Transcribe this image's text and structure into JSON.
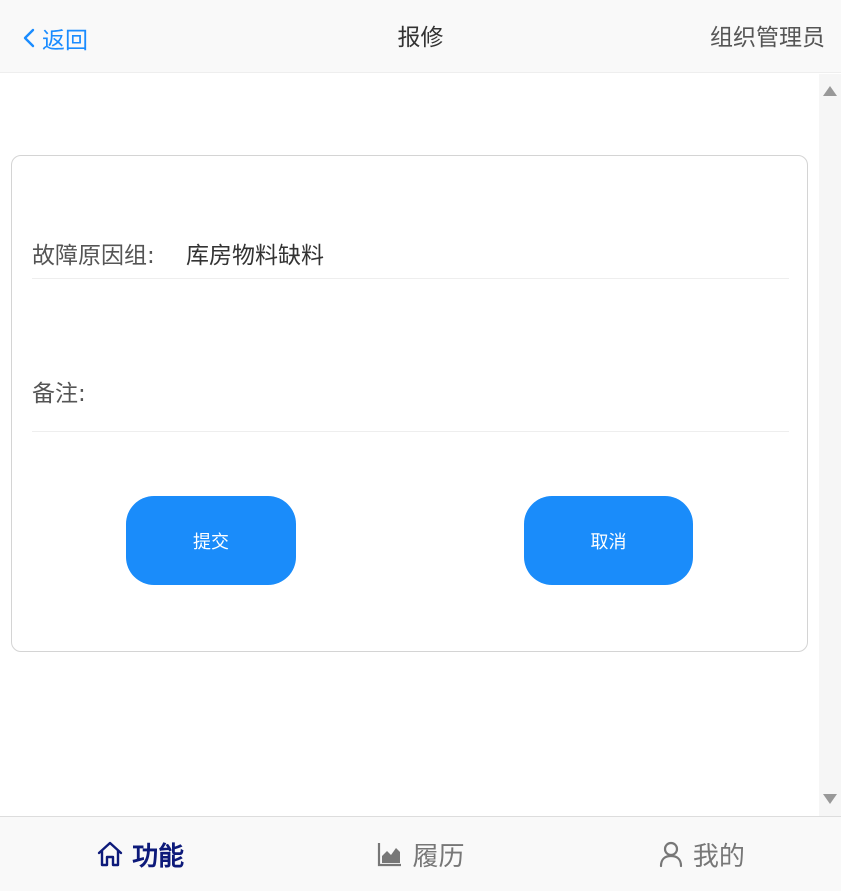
{
  "header": {
    "back_label": "返回",
    "title": "报修",
    "role": "组织管理员"
  },
  "form": {
    "reason": {
      "label": "故障原因组:",
      "value": "库房物料缺料"
    },
    "note": {
      "label": "备注:",
      "value": ""
    },
    "submit_label": "提交",
    "cancel_label": "取消"
  },
  "nav": {
    "items": [
      {
        "label": "功能",
        "icon": "home-icon",
        "active": true
      },
      {
        "label": "履历",
        "icon": "area-chart-icon",
        "active": false
      },
      {
        "label": "我的",
        "icon": "user-icon",
        "active": false
      }
    ]
  },
  "colors": {
    "accent": "#1a8cfa",
    "nav_active": "#0d1a7a"
  }
}
